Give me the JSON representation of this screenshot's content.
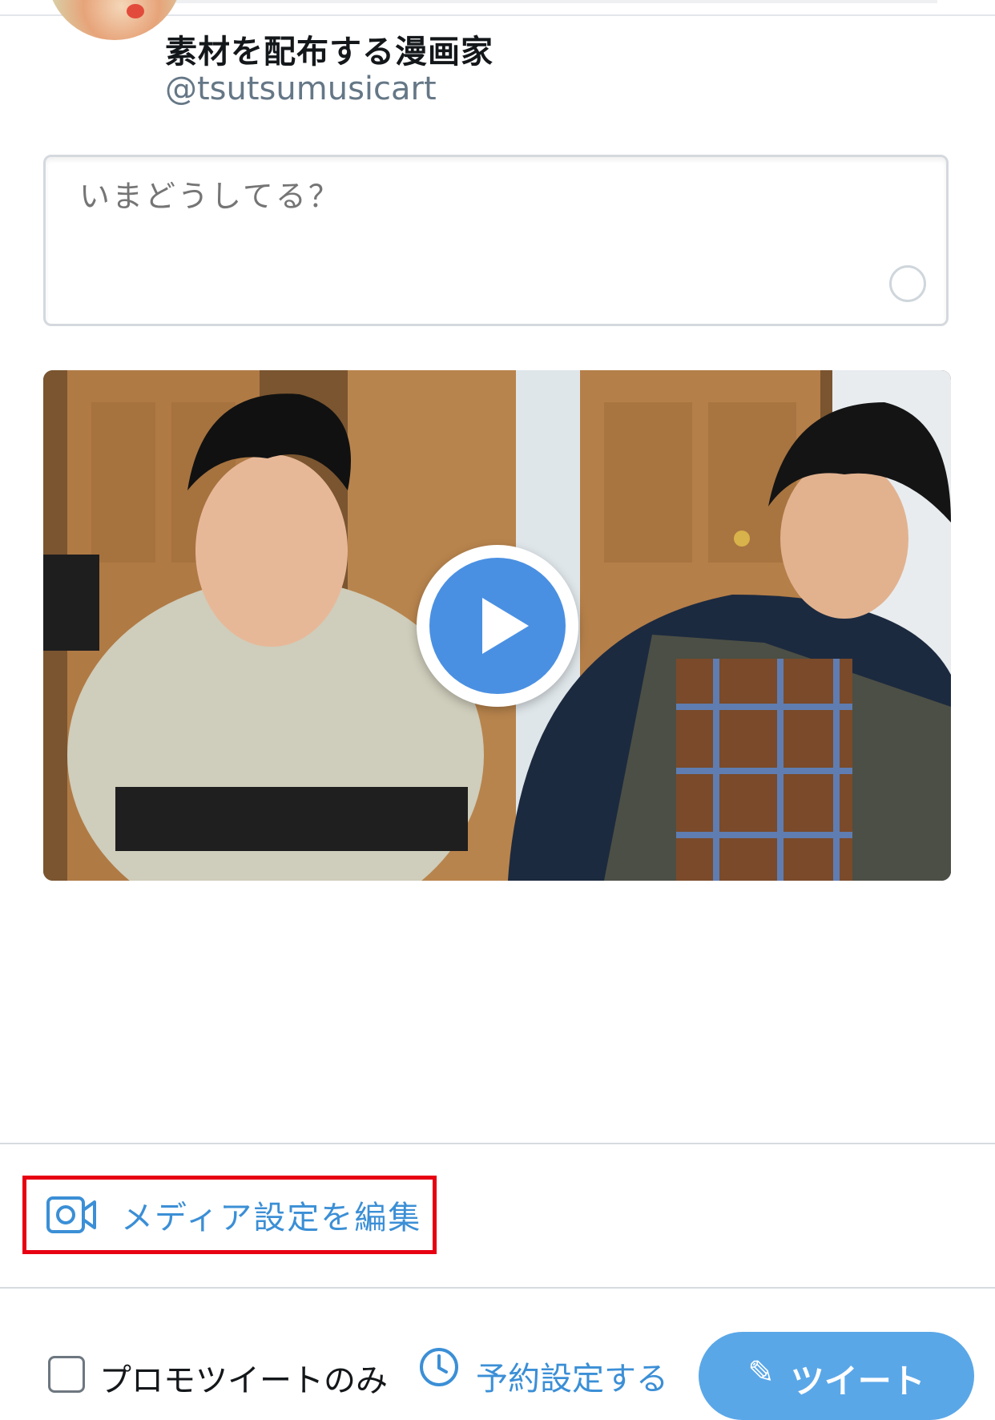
{
  "profile": {
    "display_name": "素材を配布する漫画家",
    "handle": "@tsutsumusicart"
  },
  "compose": {
    "placeholder": "いまどうしてる？"
  },
  "media": {
    "type": "video",
    "play_icon": "play-icon"
  },
  "media_settings": {
    "label": "メディア設定を編集",
    "icon": "video-camera-icon",
    "highlight_color": "#e60012"
  },
  "footer": {
    "promo_only_label": "プロモツイートのみ",
    "schedule_label": "予約設定する",
    "tweet_button_label": "ツイート"
  },
  "colors": {
    "accent": "#3b8fd6",
    "tweet_button": "#5aa7e8",
    "play_button": "#4a90e2"
  }
}
